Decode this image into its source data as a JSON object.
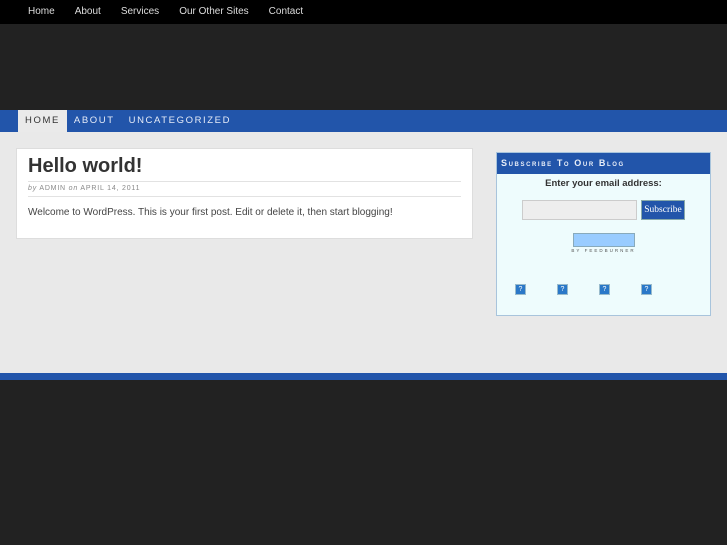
{
  "top_nav": [
    "Home",
    "About",
    "Services",
    "Our Other Sites",
    "Contact"
  ],
  "main_nav": [
    "HOME",
    "ABOUT",
    "UNCATEGORIZED"
  ],
  "post": {
    "title": "Hello world!",
    "by": "by",
    "author": "ADMIN",
    "on": "on",
    "date": "APRIL 14, 2011",
    "body": "Welcome to WordPress. This is your first post. Edit or delete it, then start blogging!"
  },
  "widget": {
    "title": "Subscribe To Our Blog",
    "label": "Enter your email address:",
    "email_value": "",
    "button": "Subscribe",
    "feedburner": "BY FEEDBURNER",
    "icon_glyph": "?"
  }
}
